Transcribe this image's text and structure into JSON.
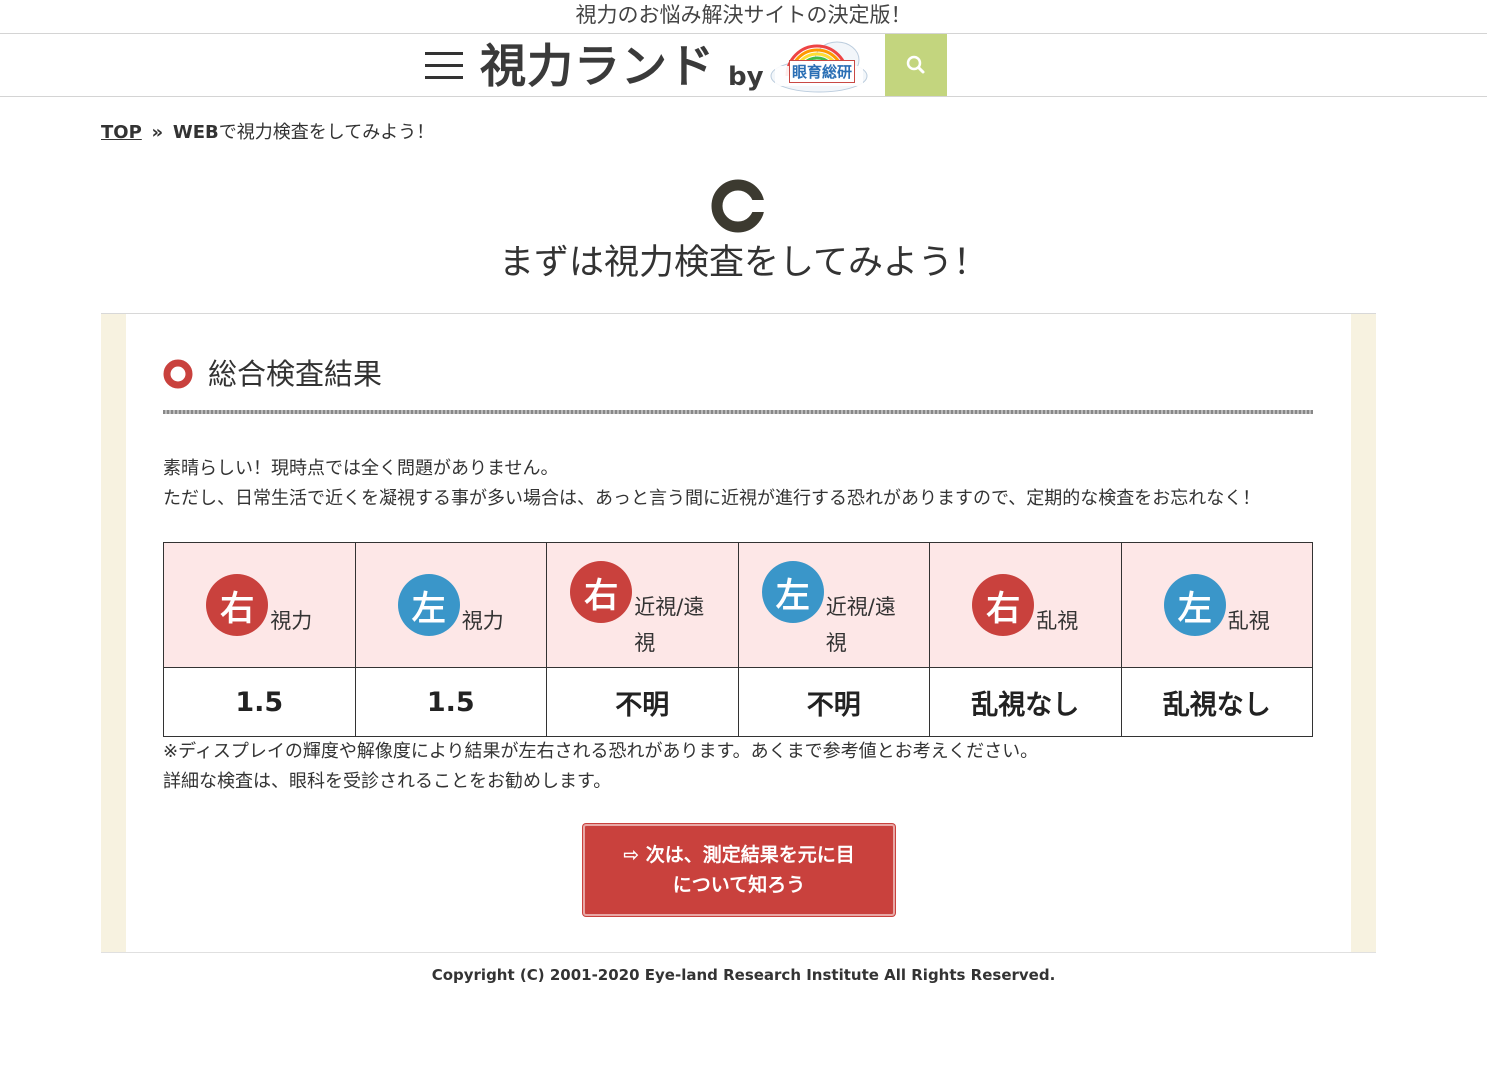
{
  "tagline": "視力のお悩み解決サイトの決定版！",
  "header": {
    "logo_text": "視力ランド",
    "logo_by": "by",
    "logo_badge": "眼育総研",
    "search_icon": "search-icon",
    "accent_color": "#c3d57e"
  },
  "breadcrumb": {
    "top": "TOP",
    "sep": "»",
    "web": "WEB",
    "current": "で視力検査をしてみよう！"
  },
  "page": {
    "title": "まずは視力検査をしてみよう！"
  },
  "result": {
    "section_title": "総合検査結果",
    "intro_line1": "素晴らしい！現時点では全く問題がありません。",
    "intro_line2": "ただし、日常生活で近くを凝視する事が多い場合は、あっと言う間に近視が進行する恐れがありますので、定期的な検査をお忘れなく！",
    "columns": [
      {
        "badge": "右",
        "side": "right",
        "label": "視力",
        "value": "1.5"
      },
      {
        "badge": "左",
        "side": "left",
        "label": "視力",
        "value": "1.5"
      },
      {
        "badge": "右",
        "side": "right",
        "label": "近視/遠視",
        "value": "不明"
      },
      {
        "badge": "左",
        "side": "left",
        "label": "近視/遠視",
        "value": "不明"
      },
      {
        "badge": "右",
        "side": "right",
        "label": "乱視",
        "value": "乱視なし"
      },
      {
        "badge": "左",
        "side": "left",
        "label": "乱視",
        "value": "乱視なし"
      }
    ],
    "note_line1": "※ディスプレイの輝度や解像度により結果が左右される恐れがあります。あくまで参考値とお考えください。",
    "note_line2": "詳細な検査は、眼科を受診されることをお勧めします。",
    "cta_line1": "⇨ 次は、測定結果を元に目",
    "cta_line2": "について知ろう"
  },
  "footer": {
    "copyright": "Copyright (C) 2001-2020 Eye-land Research Institute All Rights Reserved."
  },
  "colors": {
    "right_badge": "#c9413d",
    "left_badge": "#3a96c9",
    "table_header_bg": "#fde7e7",
    "panel_bg": "#f7f2e0",
    "cta_bg": "#c9413d"
  }
}
